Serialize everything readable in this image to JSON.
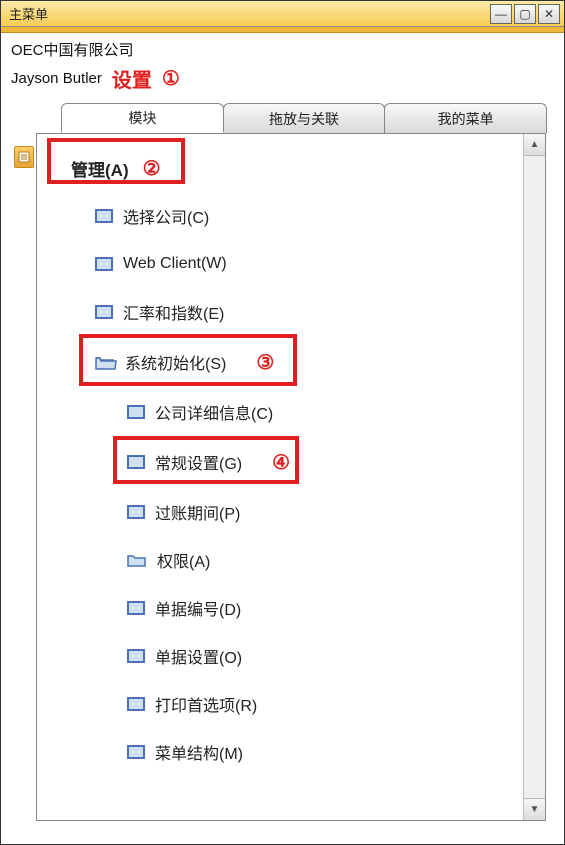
{
  "window": {
    "title": "主菜单"
  },
  "header": {
    "company": "OEC中国有限公司",
    "user": "Jayson Butler",
    "settings_label": "设置",
    "annotation1": "①"
  },
  "tabs": {
    "modules": "模块",
    "drag_assoc": "拖放与关联",
    "my_menu": "我的菜单"
  },
  "tree": {
    "admin": "管理(A)",
    "select_company": "选择公司(C)",
    "web_client": "Web Client(W)",
    "exchange_index": "汇率和指数(E)",
    "system_init": "系统初始化(S)",
    "company_details": "公司详细信息(C)",
    "general_settings": "常规设置(G)",
    "posting_periods": "过账期间(P)",
    "permissions": "权限(A)",
    "document_numbering": "单据编号(D)",
    "document_settings": "单据设置(O)",
    "print_preferences": "打印首选项(R)",
    "menu_structure": "菜单结构(M)"
  },
  "annotations": {
    "n2": "②",
    "n3": "③",
    "n4": "④"
  },
  "scroll": {
    "up": "▲",
    "down": "▼"
  },
  "winbtn": {
    "min": "—",
    "max": "▢",
    "close": "✕"
  }
}
